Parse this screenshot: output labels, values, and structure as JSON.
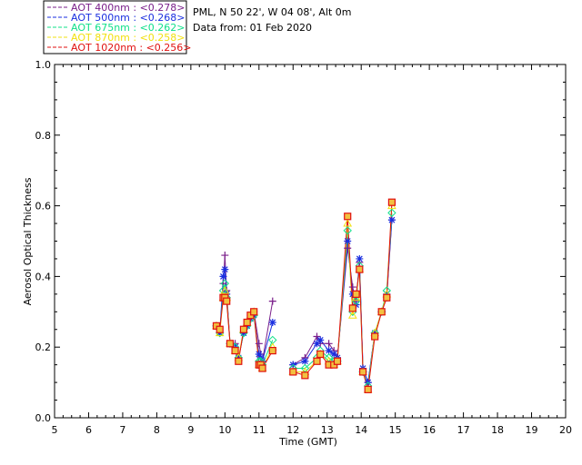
{
  "header": {
    "site": "PML, N 50 22', W 04 08', Alt 0m",
    "data_from": "Data from: 01 Feb 2020"
  },
  "legend": [
    {
      "label": "AOT  400nm : <0.278>",
      "color": "#7a1f8a",
      "marker": "plus"
    },
    {
      "label": "AOT  500nm : <0.268>",
      "color": "#1a2fe0",
      "marker": "asterisk"
    },
    {
      "label": "AOT  675nm : <0.262>",
      "color": "#10e08a",
      "marker": "diamond"
    },
    {
      "label": "AOT  870nm : <0.258>",
      "color": "#f2e010",
      "marker": "triangle"
    },
    {
      "label": "AOT 1020nm : <0.256>",
      "color": "#e01010",
      "marker": "square"
    }
  ],
  "chart_data": {
    "type": "scatter",
    "xlabel": "Time (GMT)",
    "ylabel": "Aerosol Optical Thickness",
    "xlim": [
      5,
      20
    ],
    "ylim": [
      0.0,
      1.0
    ],
    "xticks": [
      "5",
      "6",
      "7",
      "8",
      "9",
      "10",
      "11",
      "12",
      "13",
      "14",
      "15",
      "16",
      "17",
      "18",
      "19",
      "20"
    ],
    "yticks": [
      "0.0",
      "0.2",
      "0.4",
      "0.6",
      "0.8",
      "1.0"
    ],
    "grid": false,
    "series": [
      {
        "name": "AOT  400nm : <0.278>",
        "color": "#7a1f8a",
        "marker": "plus",
        "x": [
          9.75,
          9.85,
          9.95,
          10.0,
          10.05,
          10.15,
          10.3,
          10.4,
          10.55,
          10.65,
          10.75,
          10.85,
          11.0,
          11.05,
          11.1,
          11.4,
          12.0,
          12.35,
          12.7,
          12.8,
          13.05,
          13.2,
          13.3,
          13.6,
          13.75,
          13.85,
          13.95,
          14.05,
          14.2,
          14.4,
          14.6,
          14.75,
          14.9
        ],
        "y": [
          0.26,
          0.24,
          0.38,
          0.46,
          0.36,
          0.21,
          0.21,
          0.17,
          0.24,
          0.26,
          0.29,
          0.3,
          0.21,
          0.18,
          0.16,
          0.33,
          0.15,
          0.17,
          0.23,
          0.21,
          0.21,
          0.19,
          0.17,
          0.48,
          0.37,
          0.33,
          0.44,
          0.14,
          0.1,
          0.24,
          0.3,
          0.34,
          0.56
        ]
      },
      {
        "name": "AOT  500nm : <0.268>",
        "color": "#1a2fe0",
        "marker": "asterisk",
        "x": [
          9.75,
          9.85,
          9.95,
          10.0,
          10.05,
          10.15,
          10.3,
          10.4,
          10.55,
          10.65,
          10.75,
          10.85,
          11.0,
          11.05,
          11.1,
          11.4,
          12.0,
          12.35,
          12.7,
          12.8,
          13.05,
          13.2,
          13.3,
          13.6,
          13.75,
          13.85,
          13.95,
          14.05,
          14.2,
          14.4,
          14.6,
          14.75,
          14.9
        ],
        "y": [
          0.26,
          0.24,
          0.4,
          0.42,
          0.35,
          0.21,
          0.2,
          0.17,
          0.24,
          0.26,
          0.28,
          0.29,
          0.18,
          0.17,
          0.16,
          0.27,
          0.15,
          0.16,
          0.21,
          0.22,
          0.19,
          0.18,
          0.17,
          0.5,
          0.35,
          0.32,
          0.45,
          0.14,
          0.1,
          0.24,
          0.3,
          0.35,
          0.56
        ]
      },
      {
        "name": "AOT  675nm : <0.262>",
        "color": "#10e08a",
        "marker": "diamond",
        "x": [
          9.75,
          9.85,
          9.95,
          10.0,
          10.05,
          10.15,
          10.3,
          10.4,
          10.55,
          10.65,
          10.75,
          10.85,
          11.0,
          11.05,
          11.1,
          11.4,
          12.0,
          12.35,
          12.7,
          12.8,
          13.05,
          13.2,
          13.3,
          13.6,
          13.75,
          13.85,
          13.95,
          14.05,
          14.2,
          14.4,
          14.6,
          14.75,
          14.9
        ],
        "y": [
          0.26,
          0.24,
          0.36,
          0.38,
          0.34,
          0.21,
          0.2,
          0.17,
          0.24,
          0.26,
          0.28,
          0.29,
          0.16,
          0.16,
          0.15,
          0.22,
          0.14,
          0.14,
          0.17,
          0.19,
          0.17,
          0.16,
          0.16,
          0.53,
          0.3,
          0.33,
          0.43,
          0.13,
          0.09,
          0.24,
          0.3,
          0.36,
          0.58
        ]
      },
      {
        "name": "AOT  870nm : <0.258>",
        "color": "#f2e010",
        "marker": "triangle",
        "x": [
          9.75,
          9.85,
          9.95,
          10.0,
          10.05,
          10.15,
          10.3,
          10.4,
          10.55,
          10.65,
          10.75,
          10.85,
          11.0,
          11.05,
          11.1,
          11.4,
          12.0,
          12.35,
          12.7,
          12.8,
          13.05,
          13.2,
          13.3,
          13.6,
          13.75,
          13.85,
          13.95,
          14.05,
          14.2,
          14.4,
          14.6,
          14.75,
          14.9
        ],
        "y": [
          0.26,
          0.24,
          0.34,
          0.36,
          0.34,
          0.21,
          0.19,
          0.17,
          0.25,
          0.27,
          0.29,
          0.3,
          0.15,
          0.15,
          0.14,
          0.2,
          0.13,
          0.13,
          0.16,
          0.18,
          0.16,
          0.15,
          0.16,
          0.55,
          0.29,
          0.34,
          0.42,
          0.13,
          0.08,
          0.24,
          0.3,
          0.35,
          0.6
        ]
      },
      {
        "name": "AOT 1020nm : <0.256>",
        "color": "#e01010",
        "marker": "square",
        "x": [
          9.75,
          9.85,
          9.95,
          10.0,
          10.05,
          10.15,
          10.3,
          10.4,
          10.55,
          10.65,
          10.75,
          10.85,
          11.0,
          11.05,
          11.1,
          11.4,
          12.0,
          12.35,
          12.7,
          12.8,
          13.05,
          13.2,
          13.3,
          13.6,
          13.75,
          13.85,
          13.95,
          14.05,
          14.2,
          14.4,
          14.6,
          14.75,
          14.9
        ],
        "y": [
          0.26,
          0.25,
          0.34,
          0.34,
          0.33,
          0.21,
          0.19,
          0.16,
          0.25,
          0.27,
          0.29,
          0.3,
          0.15,
          0.15,
          0.14,
          0.19,
          0.13,
          0.12,
          0.16,
          0.18,
          0.15,
          0.15,
          0.16,
          0.57,
          0.31,
          0.35,
          0.42,
          0.13,
          0.08,
          0.23,
          0.3,
          0.34,
          0.61
        ]
      }
    ]
  }
}
